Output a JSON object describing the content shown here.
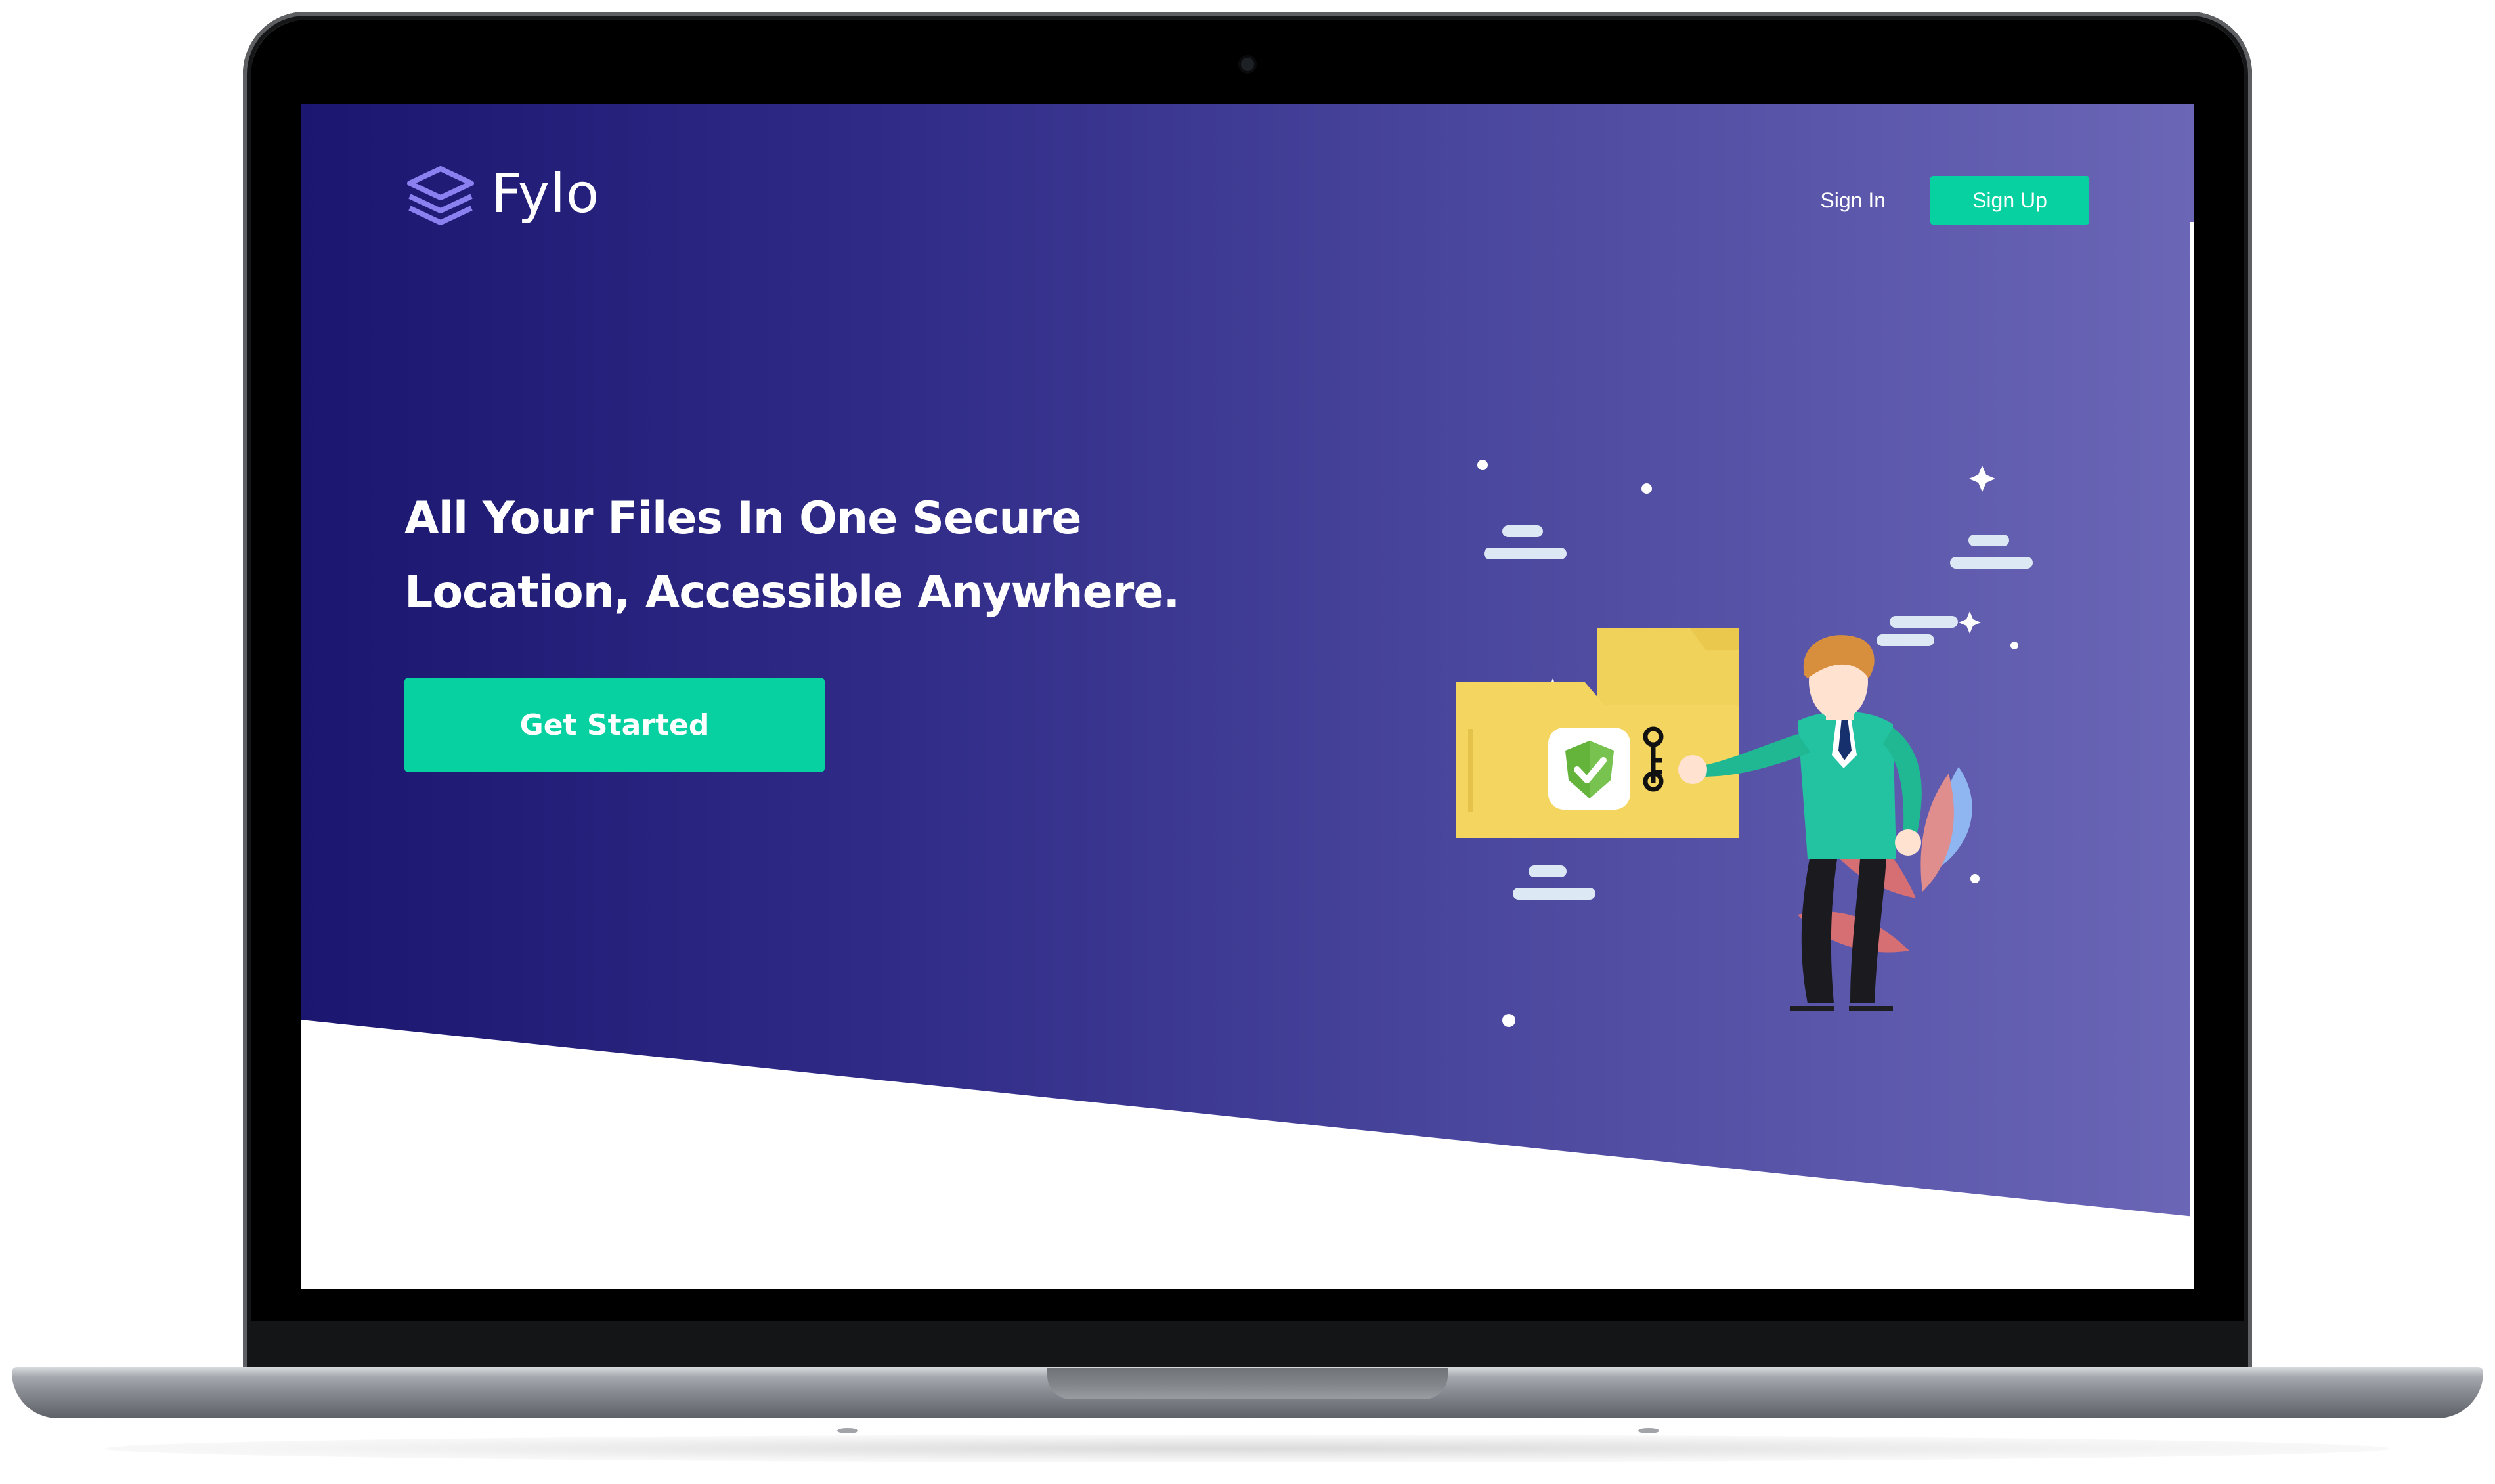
{
  "brand": {
    "name": "Fylo"
  },
  "nav": {
    "sign_in": "Sign In",
    "sign_up": "Sign Up"
  },
  "hero": {
    "headline_line1": "All Your Files In One Secure",
    "headline_line2": "Location, Accessible Anywhere.",
    "cta_label": "Get Started"
  },
  "colors": {
    "hero_gradient_start": "#1b1770",
    "hero_gradient_end": "#6b66b6",
    "accent": "#07d1a1",
    "text_on_dark": "#ffffff",
    "folder": "#f0d15a",
    "shield": "#64b43c"
  },
  "icons": {
    "logo": "stacked-layers-icon",
    "illustration": "secure-folder-illustration"
  }
}
